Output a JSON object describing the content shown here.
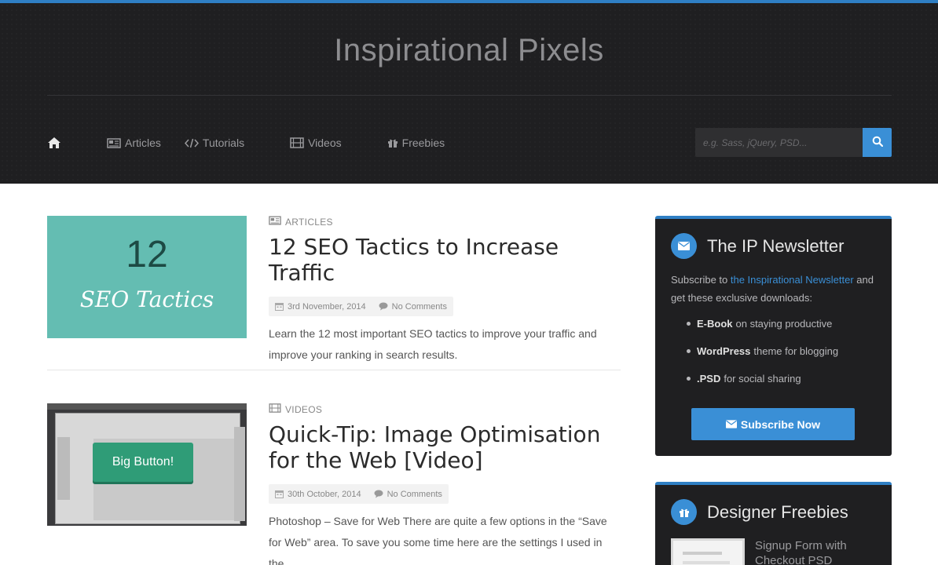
{
  "site": {
    "title": "Inspirational Pixels",
    "accent_color": "#2f7fc4",
    "button_color": "#3a8fd6"
  },
  "nav": {
    "home_icon": "home-icon",
    "items": [
      {
        "label": "Articles",
        "icon": "newspaper-icon"
      },
      {
        "label": "Tutorials",
        "icon": "code-icon"
      },
      {
        "label": "Videos",
        "icon": "film-icon"
      },
      {
        "label": "Freebies",
        "icon": "gift-icon"
      }
    ]
  },
  "search": {
    "placeholder": "e.g. Sass, jQuery, PSD...",
    "icon": "search-icon"
  },
  "posts": [
    {
      "category": "ARTICLES",
      "category_icon": "newspaper-icon",
      "title": "12 SEO Tactics to Increase Traffic",
      "date": "3rd November, 2014",
      "comments": "No Comments",
      "excerpt": "Learn the 12 most important SEO tactics to improve your traffic and improve your ranking in search results.",
      "thumb": {
        "number": "12",
        "script_text": "SEO Tactics"
      }
    },
    {
      "category": "VIDEOS",
      "category_icon": "film-icon",
      "title": "Quick-Tip: Image Optimisation for the Web [Video]",
      "date": "30th October, 2014",
      "comments": "No Comments",
      "excerpt": "Photoshop – Save for Web There are quite a few options in the “Save for Web” area. To save you some time here are the settings I used in the…",
      "thumb": {
        "button_text": "Big Button!"
      }
    }
  ],
  "sidebar": {
    "newsletter": {
      "title": "The IP Newsletter",
      "icon": "envelope-icon",
      "text_before": "Subscribe to ",
      "link": "the Inspirational Newsletter",
      "text_after": " and get these exclusive downloads:",
      "items": [
        {
          "bold": "E-Book",
          "rest": "on staying productive"
        },
        {
          "bold": "WordPress",
          "rest": "theme for blogging"
        },
        {
          "bold": ".PSD",
          "rest": "for social sharing"
        }
      ],
      "button": "Subscribe Now"
    },
    "freebies": {
      "title": "Designer Freebies",
      "icon": "gift-icon",
      "item_title": "Signup Form with Checkout PSD"
    }
  }
}
